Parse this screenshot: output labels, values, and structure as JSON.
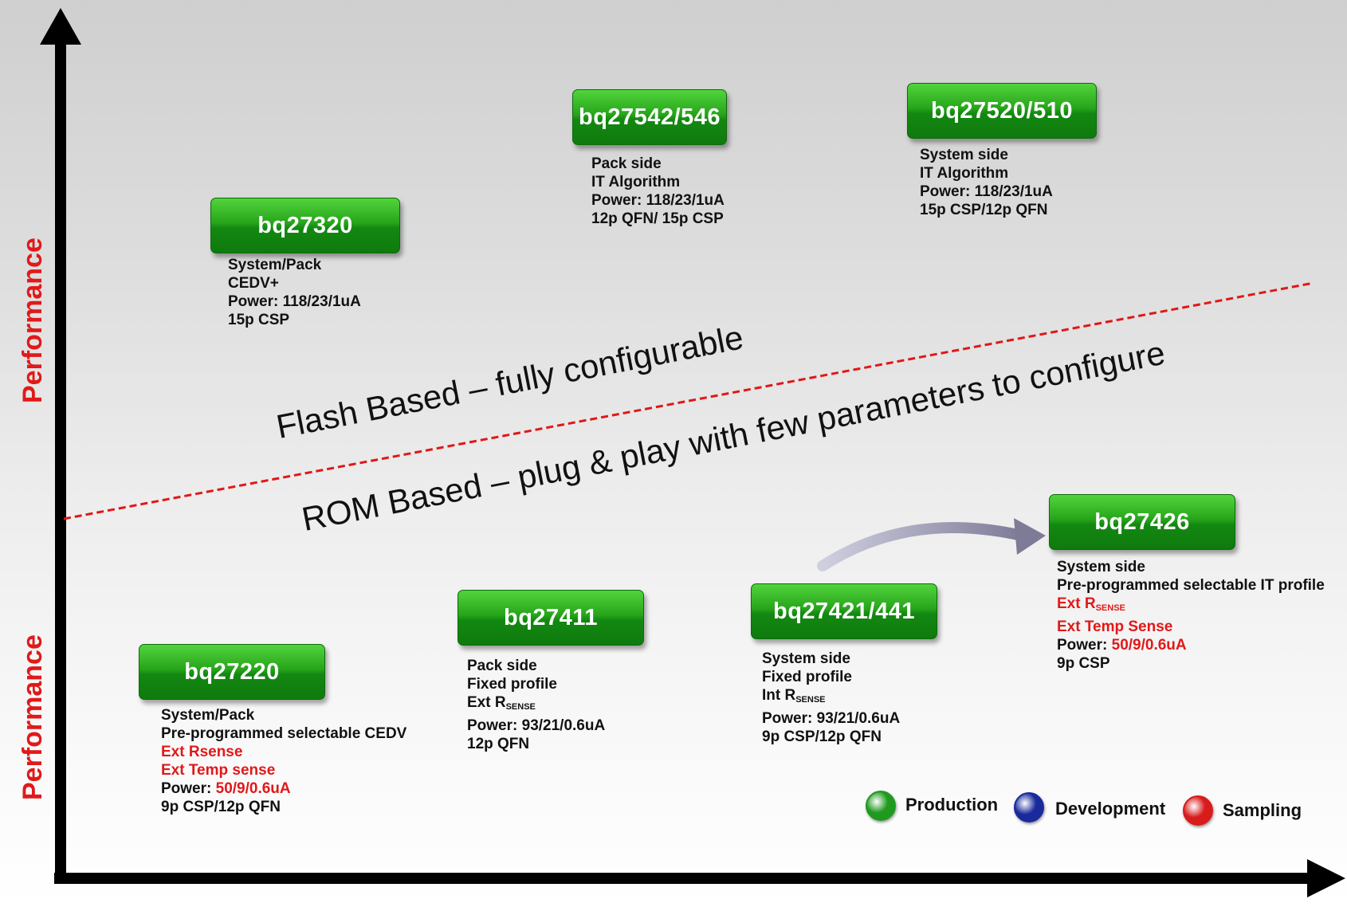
{
  "axes": {
    "y_label_upper": "Performance",
    "y_label_lower": "Performance"
  },
  "regions": {
    "flash": "Flash Based – fully configurable",
    "rom": "ROM Based – plug & play with few parameters to configure"
  },
  "legend": {
    "items": [
      {
        "label": "Production",
        "color": "#1f9a1f"
      },
      {
        "label": "Development",
        "color": "#1a2a9c"
      },
      {
        "label": "Sampling",
        "color": "#d81b1b"
      }
    ]
  },
  "products": {
    "bq27542": {
      "name": "bq27542/546",
      "lines": [
        "Pack side",
        "IT Algorithm",
        "Power: 118/23/1uA",
        "12p QFN/ 15p CSP"
      ]
    },
    "bq27520": {
      "name": "bq27520/510",
      "lines": [
        "System side",
        "IT Algorithm",
        "Power: 118/23/1uA",
        "15p CSP/12p QFN"
      ]
    },
    "bq27320": {
      "name": "bq27320",
      "lines": [
        "System/Pack",
        "CEDV+",
        "Power: 118/23/1uA",
        "15p CSP"
      ]
    },
    "bq27426": {
      "name": "bq27426",
      "line1": "System  side",
      "line2": "Pre-programmed selectable IT profile",
      "line3_prefix": "Ext  R",
      "line3_sub": "SENSE",
      "line4": "Ext Temp Sense",
      "power_prefix": "Power: ",
      "power_value": "50/9/0.6uA",
      "line6": "9p CSP"
    },
    "bq27421": {
      "name": "bq27421/441",
      "line1": "System side",
      "line2": "Fixed profile",
      "line3_prefix": "Int R",
      "line3_sub": "SENSE",
      "line4": "Power: 93/21/0.6uA",
      "line5": "9p CSP/12p QFN"
    },
    "bq27411": {
      "name": "bq27411",
      "line1": "Pack side",
      "line2": "Fixed profile",
      "line3_prefix": "Ext R",
      "line3_sub": "SENSE",
      "line4": "Power: 93/21/0.6uA",
      "line5": "12p QFN"
    },
    "bq27220": {
      "name": "bq27220",
      "line1": "System/Pack",
      "line2": "Pre-programmed selectable CEDV",
      "line3": "Ext Rsense",
      "line4": "Ext Temp sense",
      "power_prefix": "Power: ",
      "power_value": "50/9/0.6uA",
      "line6": "9p CSP/12p QFN"
    }
  }
}
